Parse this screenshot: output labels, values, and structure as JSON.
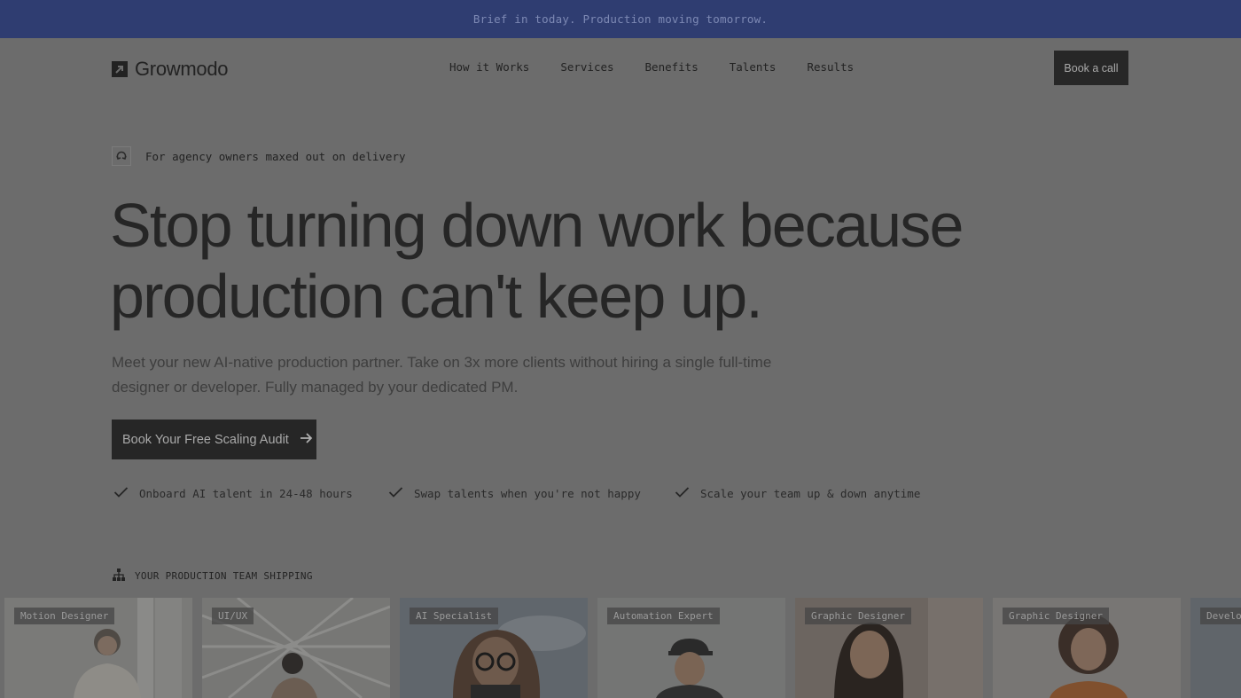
{
  "announcement": "Brief in today. Production moving tomorrow.",
  "brand": {
    "name": "Growmodo"
  },
  "nav": {
    "items": [
      "How it Works",
      "Services",
      "Benefits",
      "Talents",
      "Results"
    ],
    "cta": "Book a call"
  },
  "hero": {
    "eyebrow": "For agency owners maxed out on delivery",
    "headline_line1": "Stop turning down work because",
    "headline_line2": "production can't keep up.",
    "subtitle": "Meet your new AI-native production partner. Take on 3x more clients without hiring a single full-time designer or developer. Fully managed by your dedicated PM.",
    "cta": "Book Your Free Scaling Audit",
    "checks": [
      "Onboard AI talent in 24-48 hours",
      "Swap talents when you're not happy",
      "Scale your team up & down anytime"
    ]
  },
  "team": {
    "label": "YOUR PRODUCTION TEAM SHIPPING",
    "cards": [
      {
        "role": "Motion Designer"
      },
      {
        "role": "UI/UX"
      },
      {
        "role": "AI Specialist"
      },
      {
        "role": "Automation Expert"
      },
      {
        "role": "Graphic Designer"
      },
      {
        "role": "Graphic Designer"
      },
      {
        "role": "Develo"
      }
    ]
  },
  "colors": {
    "overlay_bg": "#6c6c6c",
    "announcement_bg": "#2f3d71",
    "button_bg": "#262626"
  },
  "icons": {
    "logo": "arrow-square-icon",
    "eyebrow": "refresh-icon",
    "cta_arrow": "arrow-right-icon",
    "check": "check-icon",
    "team": "org-chart-icon"
  }
}
